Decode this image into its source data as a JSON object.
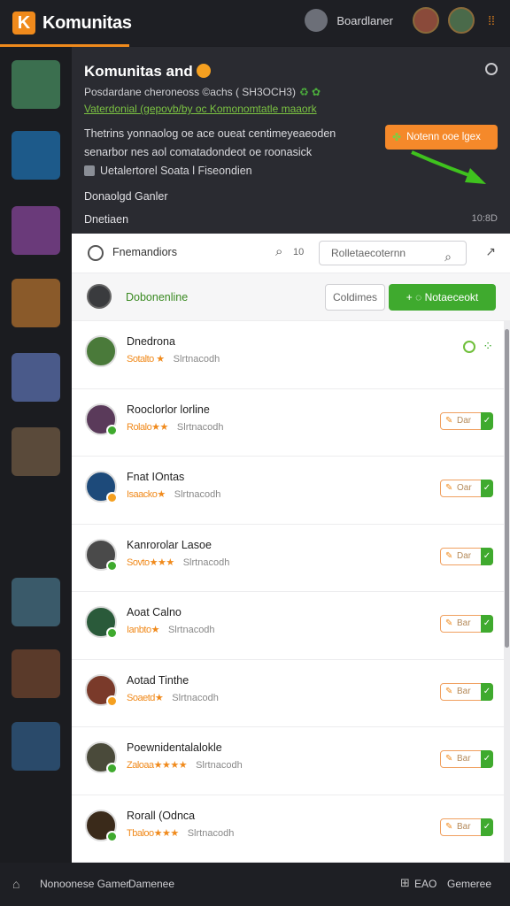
{
  "app": {
    "logo_letter": "K",
    "title": "Komunitas",
    "user_name": "Boardlaner",
    "menu_glyph": "⁞⁞"
  },
  "sidebar": {
    "thumbs": [
      {
        "name": "avatar-thumb-1",
        "color": "#3b6f4f"
      },
      {
        "name": "avatar-thumb-2",
        "color": "#1d5a8a"
      },
      {
        "name": "avatar-thumb-3",
        "color": "#6a3a7a"
      },
      {
        "name": "avatar-thumb-4",
        "color": "#8a5a2a"
      },
      {
        "name": "avatar-thumb-5",
        "color": "#4a5a8a"
      },
      {
        "name": "avatar-thumb-6",
        "color": "#5a4a3a"
      },
      {
        "name": "avatar-thumb-7",
        "color": "#3a5a6a"
      },
      {
        "name": "avatar-thumb-8",
        "color": "#5a3a2a"
      },
      {
        "name": "avatar-thumb-9",
        "color": "#2a4a6a"
      }
    ]
  },
  "hero": {
    "title": "Komunitas and",
    "subtitle": "Posdardane cheroneoss ©achs ( SH3OCH3)",
    "subtitle_icons": "♻ ✿",
    "link": "Vaterdonial (gepovb/by oc Komonomtatle maaork",
    "description": "Thetrins yonnaolog oe ace oueat centimeyeaeoden senarbor nes aol comatadondeot oe roonasick",
    "cta_label": "Notenn ooe lgex",
    "cta_icon": "✤",
    "checkbox_label": "Uetalertorel Soata l Fiseondien",
    "section_label": "Donaolgd Ganler",
    "foot_left": "Dnetiaen",
    "foot_right": "10:8D"
  },
  "filter": {
    "label": "Fnemandiors",
    "search_count": "10",
    "search_placeholder": "Rolletaecoternn"
  },
  "status": {
    "label": "Dobonenline",
    "outline_button": "Coldimes",
    "primary_button": "Notaeceokt",
    "primary_icon": "◌"
  },
  "members": [
    {
      "name": "Dnedrona",
      "stars": "Sotalto ★",
      "sub": "Slrtnacodh",
      "avatar_color": "#4a7a3a",
      "badge": "none",
      "action": "status"
    },
    {
      "name": "Rooclorlor lorline",
      "stars": "Rolalo★★",
      "sub": "Slrtnacodh",
      "avatar_color": "#5a3a5a",
      "badge": "green",
      "action": "Dar"
    },
    {
      "name": "Fnat IOntas",
      "stars": "Isaacko★",
      "sub": "Slrtnacodh",
      "avatar_color": "#1d4a7a",
      "badge": "orange",
      "action": "Oar"
    },
    {
      "name": "Kanrorolar Lasoe",
      "stars": "Sovto★★★",
      "sub": "Slrtnacodh",
      "avatar_color": "#4a4a4a",
      "badge": "green",
      "action": "Dar"
    },
    {
      "name": "Aoat Calno",
      "stars": "Ianbto★",
      "sub": "Slrtnacodh",
      "avatar_color": "#2a5a3a",
      "badge": "green",
      "action": "Bar"
    },
    {
      "name": "Aotad Tinthe",
      "stars": "Soaetd★",
      "sub": "Slrtnacodh",
      "avatar_color": "#7a3a2a",
      "badge": "orange",
      "action": "Bar"
    },
    {
      "name": "Poewnidentalalokle",
      "stars": "Zaloaa★★★★",
      "sub": "Slrtnacodh",
      "avatar_color": "#4a4a3a",
      "badge": "green",
      "action": "Bar"
    },
    {
      "name": "Rorall (Odnca",
      "stars": "Tbaloo★★★",
      "sub": "Slrtnacodh",
      "avatar_color": "#3a2a1a",
      "badge": "green",
      "action": "Bar"
    },
    {
      "name": "",
      "stars": "",
      "sub": "",
      "avatar_color": "#3a3a3a",
      "badge": "none",
      "action": "none"
    }
  ],
  "bottom": {
    "home_icon": "⌂",
    "left1": "Nonoonese Gamer",
    "left2": "Damenee",
    "right_icon": "⊞",
    "right1": "EAO",
    "right2": "Gemeree"
  },
  "colors": {
    "accent": "#f08a1c",
    "green": "#3faa2e"
  }
}
